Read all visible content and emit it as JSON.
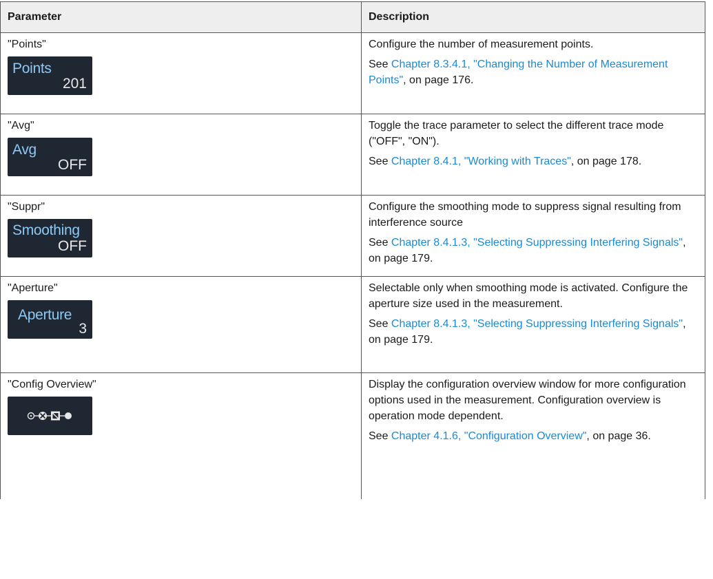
{
  "header": {
    "col_parameter": "Parameter",
    "col_description": "Description"
  },
  "rows": [
    {
      "name": "\"Points\"",
      "widget": {
        "label": "Points",
        "value": "201"
      },
      "desc": "Configure the number of measurement points.",
      "see_prefix": "See ",
      "link": "Chapter 8.3.4.1, \"Changing the Number of Measurement Points\"",
      "see_suffix": ", on page 176."
    },
    {
      "name": "\"Avg\"",
      "widget": {
        "label": "Avg",
        "value": "OFF"
      },
      "desc": "Toggle the trace parameter to select the different trace mode (\"OFF\", \"ON\").",
      "see_prefix": "See ",
      "link": "Chapter 8.4.1, \"Working with Traces\"",
      "see_suffix": ", on page 178."
    },
    {
      "name": "\"Suppr\"",
      "widget": {
        "label": "Smoothing",
        "value": "OFF"
      },
      "desc": "Configure the smoothing mode to suppress signal resulting from interference source",
      "see_prefix": "See ",
      "link": "Chapter 8.4.1.3, \"Selecting Suppressing Interfering Signals\"",
      "see_suffix": ", on page 179."
    },
    {
      "name": "\"Aperture\"",
      "widget": {
        "label": "Aperture",
        "value": "3"
      },
      "desc": "Selectable only when smoothing mode is activated. Configure the aperture size used in the measurement.",
      "see_prefix": "See ",
      "link": "Chapter 8.4.1.3, \"Selecting Suppressing Interfering Signals\"",
      "see_suffix": ", on page 179."
    },
    {
      "name": "\"Config Overview\"",
      "widget": {
        "icon": "signal-chain-icon"
      },
      "desc": "Display the configuration overview window for more configuration options used in the measurement. Configuration overview is operation mode dependent.",
      "see_prefix": "See ",
      "link": "Chapter 4.1.6, \"Configuration Overview\"",
      "see_suffix": ", on page 36."
    }
  ],
  "colors": {
    "link": "#1a8ad4",
    "widget_bg": "#1f2733",
    "widget_label": "#8cc9f5",
    "widget_value": "#e8e8e8",
    "header_bg": "#eeeeee"
  }
}
